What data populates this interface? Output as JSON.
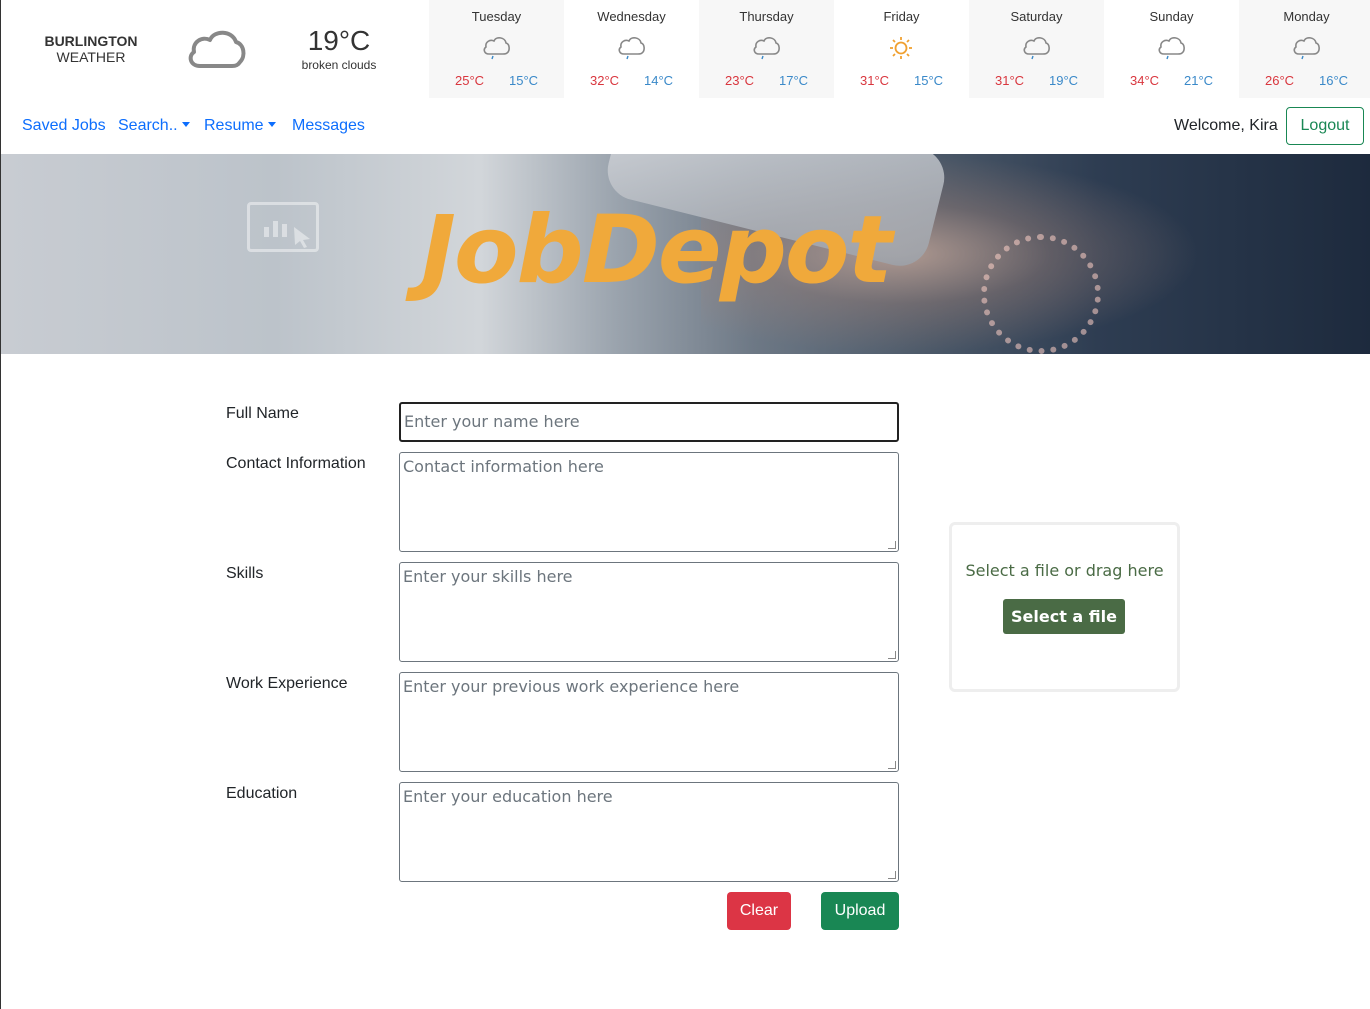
{
  "weather": {
    "city_line1": "BURLINGTON",
    "city_line2": "WEATHER",
    "current_temp": "19°C",
    "current_desc": "broken clouds",
    "current_icon": "cloud-icon",
    "forecast": [
      {
        "day": "Tuesday",
        "icon": "rain-cloud-icon",
        "hi": "25°C",
        "lo": "15°C"
      },
      {
        "day": "Wednesday",
        "icon": "rain-cloud-icon",
        "hi": "32°C",
        "lo": "14°C"
      },
      {
        "day": "Thursday",
        "icon": "rain-cloud-icon",
        "hi": "23°C",
        "lo": "17°C"
      },
      {
        "day": "Friday",
        "icon": "sun-icon",
        "hi": "31°C",
        "lo": "15°C"
      },
      {
        "day": "Saturday",
        "icon": "rain-cloud-icon",
        "hi": "31°C",
        "lo": "19°C"
      },
      {
        "day": "Sunday",
        "icon": "rain-cloud-icon",
        "hi": "34°C",
        "lo": "21°C"
      },
      {
        "day": "Monday",
        "icon": "rain-cloud-icon",
        "hi": "26°C",
        "lo": "16°C"
      }
    ],
    "colors": {
      "hi": "#d9363e",
      "lo": "#3a89c9"
    }
  },
  "nav": {
    "saved_jobs": "Saved Jobs",
    "search": "Search..",
    "resume": "Resume",
    "messages": "Messages",
    "welcome": "Welcome, Kira",
    "logout": "Logout"
  },
  "banner": {
    "brand": "JobDepot",
    "brand_color": "#f0a93b"
  },
  "form": {
    "full_name": {
      "label": "Full Name",
      "placeholder": "Enter your name here",
      "value": ""
    },
    "contact": {
      "label": "Contact Information",
      "placeholder": "Contact information here",
      "value": ""
    },
    "skills": {
      "label": "Skills",
      "placeholder": "Enter your skills here",
      "value": ""
    },
    "experience": {
      "label": "Work Experience",
      "placeholder": "Enter your previous work experience here",
      "value": ""
    },
    "education": {
      "label": "Education",
      "placeholder": "Enter your education here",
      "value": ""
    },
    "clear": "Clear",
    "upload": "Upload"
  },
  "dropzone": {
    "hint": "Select a file or drag here",
    "button": "Select a file"
  },
  "colors": {
    "link": "#0d6efd",
    "success": "#198754",
    "danger": "#dc3545",
    "dropzone_green": "#4a6b45"
  }
}
